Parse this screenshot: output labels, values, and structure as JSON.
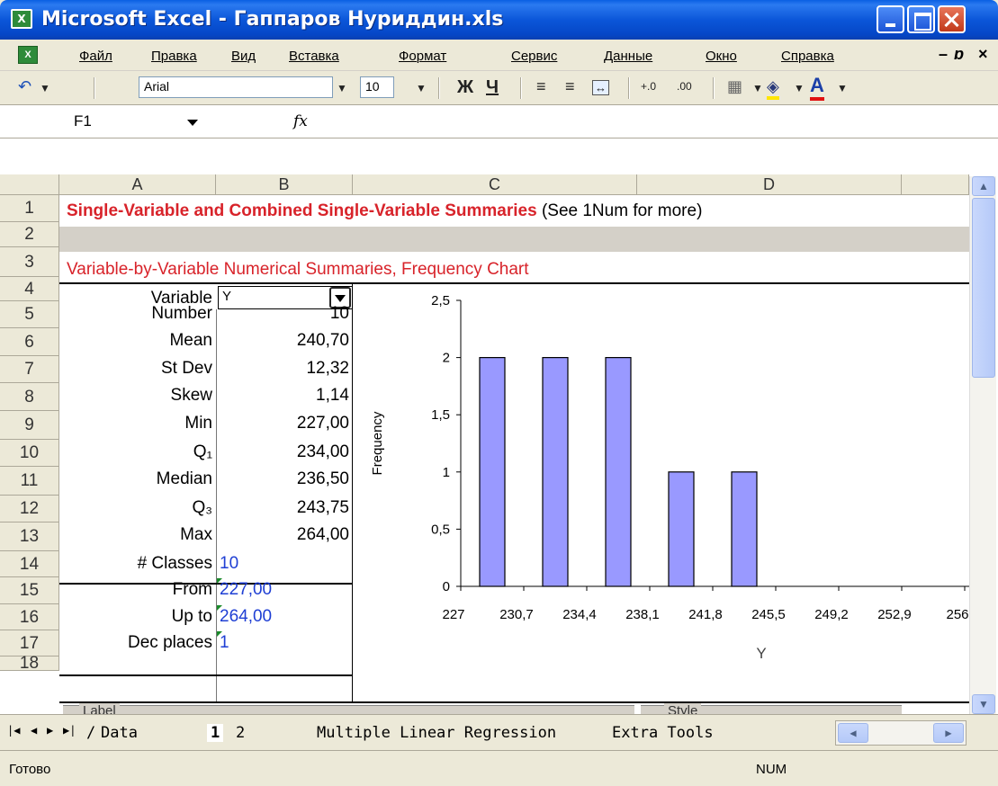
{
  "window": {
    "title": "Microsoft Excel - Гаппаров Нуриддин.xls",
    "app_icon": "excel-icon"
  },
  "menu": [
    "Файл",
    "Правка",
    "Вид",
    "Вставка",
    "Формат",
    "Сервис",
    "Данные",
    "Окно",
    "Справка"
  ],
  "toolbar": {
    "font_name": "Arial",
    "font_size": "10",
    "bold": "Ж",
    "underline": "Ч"
  },
  "formula": {
    "cell_ref": "F1",
    "fx": "fx"
  },
  "columns": [
    "A",
    "B",
    "C",
    "D"
  ],
  "rows": [
    "1",
    "2",
    "3",
    "4",
    "5",
    "6",
    "7",
    "8",
    "9",
    "10",
    "11",
    "12",
    "13",
    "14",
    "15",
    "16",
    "17",
    "18"
  ],
  "sheet": {
    "title_bold": "Single-Variable and Combined Single-Variable Summaries",
    "title_note": "(See 1Num for more)",
    "subtitle": "Variable-by-Variable Numerical Summaries, Frequency Chart",
    "variable_label": "Variable",
    "variable_value": "Y",
    "stats": [
      {
        "label": "Number",
        "value": "10"
      },
      {
        "label": "Mean",
        "value": "240,70"
      },
      {
        "label": "St Dev",
        "value": "12,32"
      },
      {
        "label": "Skew",
        "value": "1,14"
      },
      {
        "label": "Min",
        "value": "227,00"
      },
      {
        "label": "Q₁",
        "value": "234,00"
      },
      {
        "label": "Median",
        "value": "236,50"
      },
      {
        "label": "Q₃",
        "value": "243,75"
      },
      {
        "label": "Max",
        "value": "264,00"
      }
    ],
    "settings": [
      {
        "label": "# Classes",
        "value": "10"
      },
      {
        "label": "From",
        "value": "227,00"
      },
      {
        "label": "Up to",
        "value": "264,00"
      },
      {
        "label": "Dec places",
        "value": "1"
      }
    ],
    "row18_left": "Label",
    "row18_right": "Style"
  },
  "chart_data": {
    "type": "bar",
    "categories": [
      "227",
      "230,7",
      "234,4",
      "238,1",
      "241,8",
      "245,5",
      "249,2",
      "252,9",
      "256"
    ],
    "values": [
      2,
      2,
      2,
      1,
      1,
      0,
      0,
      0,
      0
    ],
    "yticks": [
      "0",
      "0,5",
      "1",
      "1,5",
      "2",
      "2,5"
    ],
    "ylim": [
      0,
      2.5
    ],
    "xlabel": "Y",
    "ylabel": "Frequency",
    "bar_color": "#9999ff"
  },
  "tabs": [
    "Data",
    "1",
    "2",
    "Multiple Linear Regression",
    "Extra Tools"
  ],
  "status": {
    "left": "Готово",
    "right": "NUM"
  },
  "colors": {
    "title_red": "#d8232a",
    "value_blue": "#1f3fd4",
    "xp_blue": "#0b56d9"
  }
}
